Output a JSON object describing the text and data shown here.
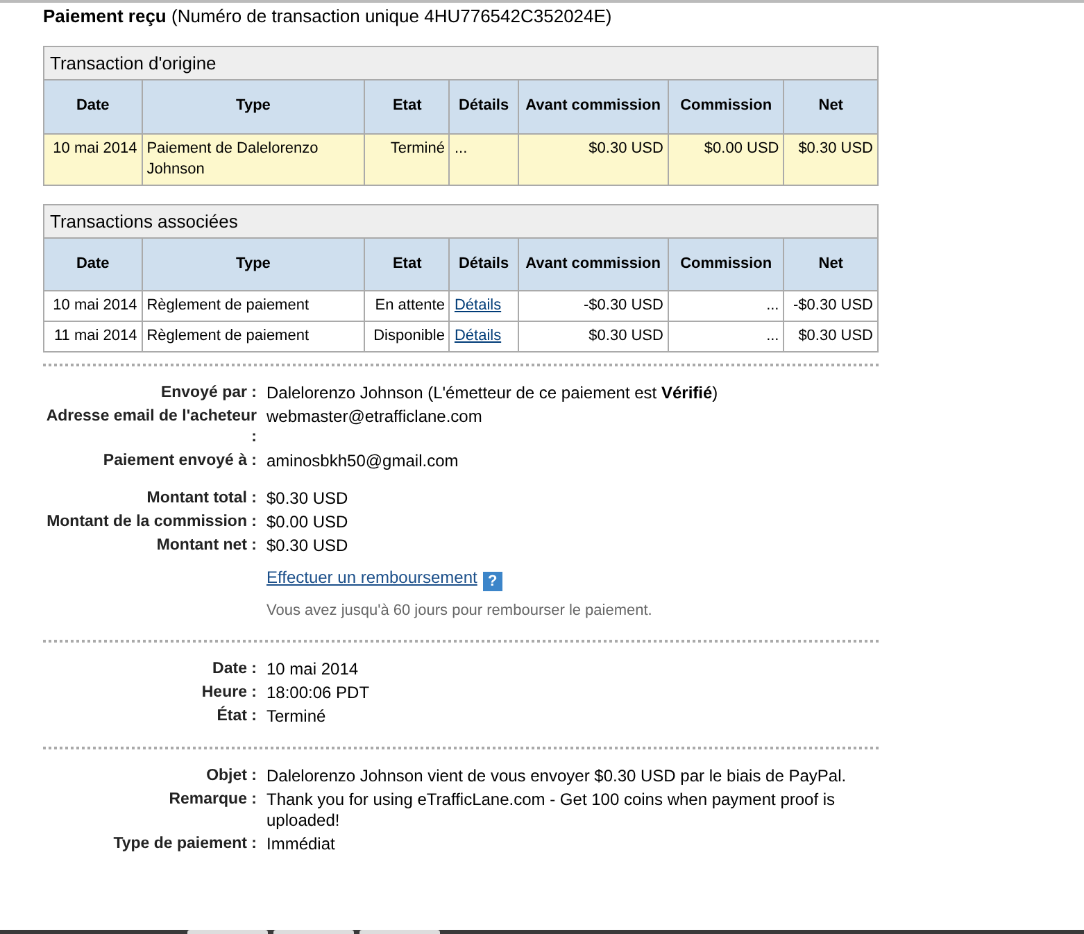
{
  "header": {
    "title": "Paiement reçu",
    "subtitle": "(Numéro de transaction unique 4HU776542C352024E)"
  },
  "tables": [
    {
      "caption": "Transaction d'origine",
      "columns": [
        "Date",
        "Type",
        "Etat",
        "Détails",
        "Avant commission",
        "Commission",
        "Net"
      ],
      "rows": [
        {
          "highlighted": true,
          "cells": [
            {
              "kind": "text",
              "text": "10 mai 2014"
            },
            {
              "kind": "text",
              "text": "Paiement de Dalelorenzo Johnson"
            },
            {
              "kind": "text",
              "text": "Terminé"
            },
            {
              "kind": "text",
              "text": "..."
            },
            {
              "kind": "text",
              "text": "$0.30 USD"
            },
            {
              "kind": "text",
              "text": "$0.00 USD"
            },
            {
              "kind": "text",
              "text": "$0.30 USD"
            }
          ]
        }
      ]
    },
    {
      "caption": "Transactions associées",
      "columns": [
        "Date",
        "Type",
        "Etat",
        "Détails",
        "Avant commission",
        "Commission",
        "Net"
      ],
      "rows": [
        {
          "highlighted": false,
          "cells": [
            {
              "kind": "text",
              "text": "10 mai 2014"
            },
            {
              "kind": "text",
              "text": "Règlement de paiement"
            },
            {
              "kind": "text",
              "text": "En attente"
            },
            {
              "kind": "link",
              "text": "Détails"
            },
            {
              "kind": "text",
              "text": "-$0.30 USD"
            },
            {
              "kind": "text",
              "text": "..."
            },
            {
              "kind": "text",
              "text": "-$0.30 USD"
            }
          ]
        },
        {
          "highlighted": false,
          "cells": [
            {
              "kind": "text",
              "text": "11 mai 2014"
            },
            {
              "kind": "text",
              "text": "Règlement de paiement"
            },
            {
              "kind": "text",
              "text": "Disponible"
            },
            {
              "kind": "link",
              "text": "Détails"
            },
            {
              "kind": "text",
              "text": "$0.30 USD"
            },
            {
              "kind": "text",
              "text": "..."
            },
            {
              "kind": "text",
              "text": "$0.30 USD"
            }
          ]
        }
      ]
    }
  ],
  "sections": [
    {
      "groups": [
        {
          "rows": [
            {
              "label": "Envoyé par :",
              "value": "Dalelorenzo Johnson (L'émetteur de ce paiement est **Vérifié**)"
            },
            {
              "label": "Adresse email de l'acheteur :",
              "value": "webmaster@etrafficlane.com"
            },
            {
              "label": "Paiement envoyé à :",
              "value": "aminosbkh50@gmail.com"
            }
          ]
        },
        {
          "rows": [
            {
              "label": "Montant total :",
              "value": "$0.30 USD"
            },
            {
              "label": "Montant de la commission :",
              "value": "$0.00 USD"
            },
            {
              "label": "Montant net :",
              "value": "$0.30 USD"
            }
          ],
          "refund": {
            "link": "Effectuer un remboursement",
            "help": "?",
            "note": "Vous avez jusqu'à 60 jours pour rembourser le paiement."
          }
        }
      ]
    },
    {
      "groups": [
        {
          "rows": [
            {
              "label": "Date :",
              "value": "10 mai 2014"
            },
            {
              "label": "Heure :",
              "value": "18:00:06 PDT"
            },
            {
              "label": "État :",
              "value": "Terminé"
            }
          ]
        }
      ]
    },
    {
      "groups": [
        {
          "rows": [
            {
              "label": "Objet :",
              "value": "Dalelorenzo Johnson vient de vous envoyer $0.30 USD par le biais de PayPal."
            },
            {
              "label": "Remarque :",
              "value": "Thank you for using eTrafficLane.com - Get 100 coins when payment proof is uploaded!"
            },
            {
              "label": "Type de paiement :",
              "value": "Immédiat"
            }
          ]
        }
      ]
    }
  ]
}
